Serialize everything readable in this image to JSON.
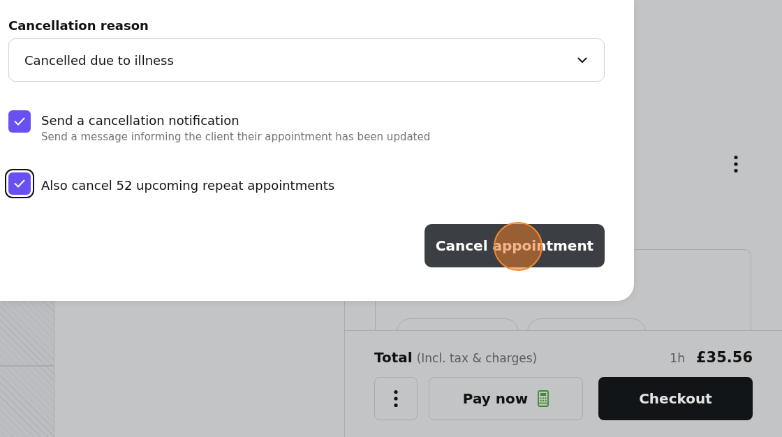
{
  "modal": {
    "reason_label": "Cancellation reason",
    "reason_select": {
      "value": "Cancelled due to illness"
    },
    "options": [
      {
        "label": "Send a cancellation notification",
        "description": "Send a message informing the client their appointment has been updated",
        "checked": true
      },
      {
        "label": "Also cancel 52 upcoming repeat appointments",
        "checked": true,
        "focused": true
      }
    ],
    "confirm_button": "Cancel appointment"
  },
  "footer": {
    "total_label": "Total",
    "total_note": "(Incl. tax & charges)",
    "duration": "1h",
    "amount": "£35.56",
    "pay_button": "Pay now",
    "checkout_button": "Checkout"
  }
}
